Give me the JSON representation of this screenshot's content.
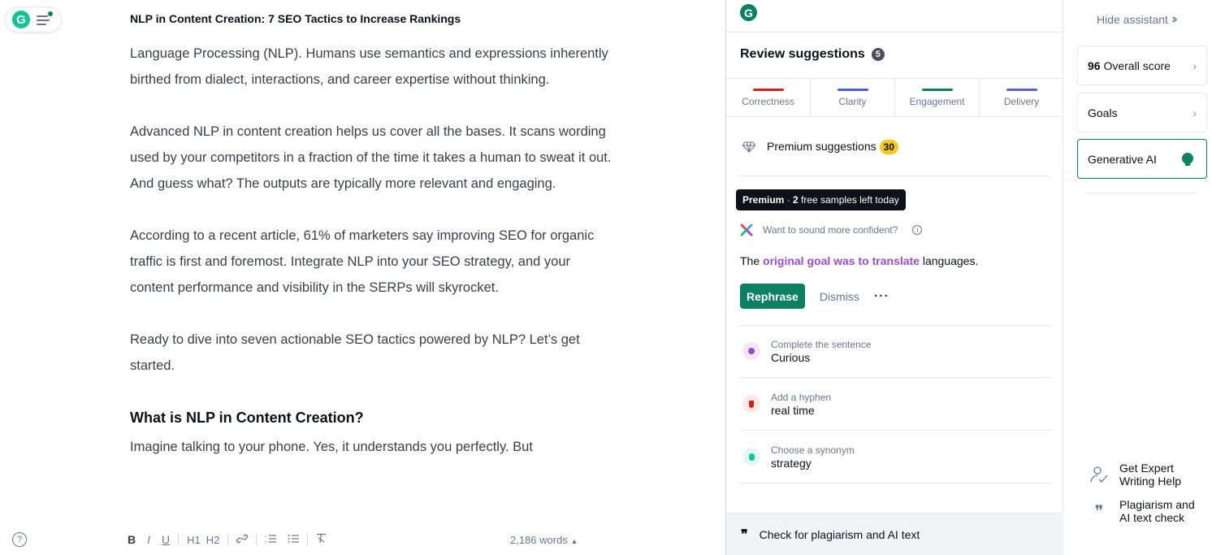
{
  "header": {
    "doc_title": "NLP in Content Creation: 7 SEO Tactics to Increase Rankings"
  },
  "editor": {
    "paragraphs": [
      "Language Processing (NLP). Humans use semantics and expressions inherently birthed from dialect, interactions, and career expertise without thinking.",
      "Advanced NLP in content creation helps us cover all the bases. It scans wording used by your competitors in a fraction of the time it takes a human to sweat it out. And guess what? The outputs are typically more relevant and engaging.",
      "According to a recent article, 61% of marketers say improving SEO for organic traffic is first and foremost. Integrate NLP into your SEO strategy, and your content performance and visibility in the SERPs will skyrocket.",
      "Ready to dive into seven actionable SEO tactics powered by NLP? Let’s get started."
    ],
    "heading": "What is NLP in Content Creation?",
    "last_paragraph": "Imagine talking to your phone. Yes, it understands you perfectly. But"
  },
  "toolbar": {
    "bold": "B",
    "italic": "I",
    "underline": "U",
    "h1": "H1",
    "h2": "H2",
    "link_icon": "link-icon",
    "ordered_list_icon": "ordered-list-icon",
    "bullet_list_icon": "bullet-list-icon",
    "clear_format_icon": "clear-format-icon",
    "word_count": "2,186 words"
  },
  "panel": {
    "review_title": "Review suggestions",
    "review_count": "5",
    "categories": [
      {
        "label": "Correctness",
        "color": "#d9201a"
      },
      {
        "label": "Clarity",
        "color": "#4a5ae3"
      },
      {
        "label": "Engagement",
        "color": "#0b8062"
      },
      {
        "label": "Delivery",
        "color": "#5a5fd4"
      }
    ],
    "premium_label": "Premium suggestions",
    "premium_count": "30",
    "tooltip_bold": "Premium",
    "tooltip_mid": " · ",
    "tooltip_count": "2",
    "tooltip_rest": " free samples left today",
    "confident_label": "Want to sound more confident?",
    "sentence_pre": "The ",
    "sentence_hl": "original goal was to translate",
    "sentence_post": " languages.",
    "rephrase_label": "Rephrase",
    "dismiss_label": "Dismiss",
    "more_label": "···",
    "suggestions": [
      {
        "kind": "Complete the sentence",
        "text": "Curious",
        "color": "#9b4dc9"
      },
      {
        "kind": "Add a hyphen",
        "text": "real time",
        "color": "#d9201a"
      },
      {
        "kind": "Choose a synonym",
        "text": "strategy",
        "color": "#15c39a"
      }
    ],
    "plagiarism_label": "Check for plagiarism and AI text"
  },
  "sidebar": {
    "hide_label": "Hide assistant",
    "overall_score": "96",
    "overall_label": "Overall score",
    "goals_label": "Goals",
    "genai_label": "Generative AI",
    "expert_line1": "Get Expert",
    "expert_line2": "Writing Help",
    "plag_line1": "Plagiarism and",
    "plag_line2": "AI text check"
  }
}
